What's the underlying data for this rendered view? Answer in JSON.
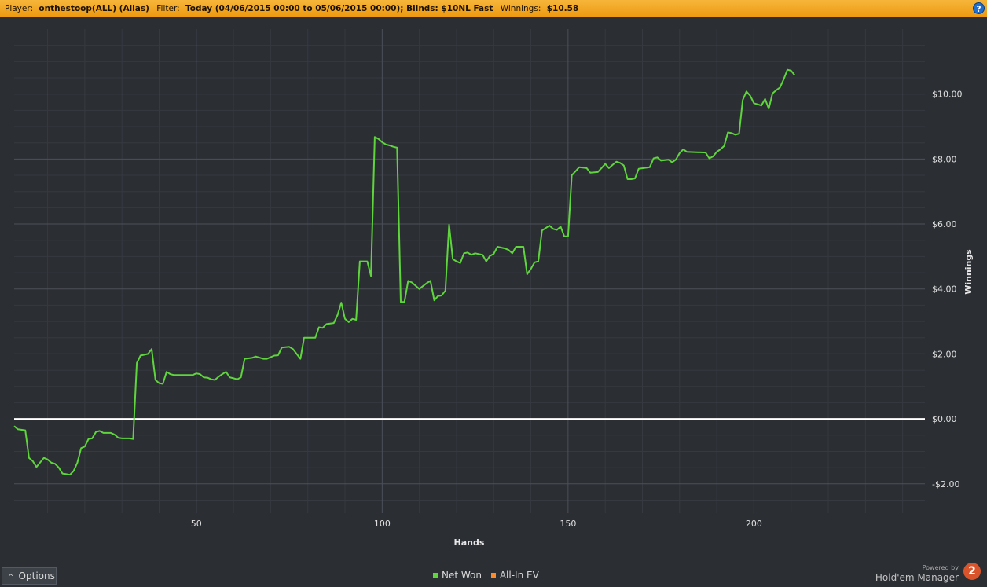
{
  "header": {
    "player_label": "Player:",
    "player_value": "onthestoop(ALL) (Alias)",
    "filter_label": "Filter:",
    "filter_value": "Today (04/06/2015 00:00 to 05/06/2015 00:00); Blinds: $10NL Fast",
    "winnings_label": "Winnings:",
    "winnings_value": "$10.58",
    "help_icon": "question-icon",
    "help_glyph": "?"
  },
  "colors": {
    "header_bg": "#f2a623",
    "net_won": "#5fd43c",
    "all_in_ev": "#ff8a2a",
    "zero_line": "#ffffff",
    "plot_bg": "#2b2e33"
  },
  "chart_data": {
    "type": "line",
    "xlabel": "Hands",
    "ylabel": "Winnings",
    "xlim": [
      1,
      246
    ],
    "ylim": [
      -2.9,
      12
    ],
    "x_ticks": [
      50,
      100,
      150,
      200
    ],
    "x_tick_labels": [
      "50",
      "100",
      "150",
      "200"
    ],
    "y_ticks": [
      -2,
      0,
      2,
      4,
      6,
      8,
      10
    ],
    "y_tick_labels": [
      "-$2.00",
      "$0.00",
      "$2.00",
      "$4.00",
      "$6.00",
      "$8.00",
      "$10.00"
    ],
    "grid": true,
    "legend_position": "bottom-center",
    "series": [
      {
        "name": "Net Won",
        "points": [
          [
            1,
            -0.22
          ],
          [
            2,
            -0.32
          ],
          [
            4,
            -0.35
          ],
          [
            5,
            -1.2
          ],
          [
            6,
            -1.3
          ],
          [
            7,
            -1.48
          ],
          [
            9,
            -1.2
          ],
          [
            10,
            -1.25
          ],
          [
            11,
            -1.35
          ],
          [
            12,
            -1.38
          ],
          [
            13,
            -1.5
          ],
          [
            14,
            -1.68
          ],
          [
            15,
            -1.7
          ],
          [
            16,
            -1.72
          ],
          [
            17,
            -1.6
          ],
          [
            18,
            -1.35
          ],
          [
            19,
            -0.9
          ],
          [
            20,
            -0.85
          ],
          [
            21,
            -0.62
          ],
          [
            22,
            -0.6
          ],
          [
            23,
            -0.4
          ],
          [
            24,
            -0.37
          ],
          [
            25,
            -0.43
          ],
          [
            27,
            -0.43
          ],
          [
            28,
            -0.48
          ],
          [
            29,
            -0.58
          ],
          [
            30,
            -0.6
          ],
          [
            32,
            -0.6
          ],
          [
            33,
            -0.62
          ],
          [
            34,
            1.72
          ],
          [
            35,
            1.95
          ],
          [
            37,
            2.0
          ],
          [
            38,
            2.15
          ],
          [
            39,
            1.2
          ],
          [
            40,
            1.1
          ],
          [
            41,
            1.08
          ],
          [
            42,
            1.45
          ],
          [
            43,
            1.38
          ],
          [
            44,
            1.35
          ],
          [
            49,
            1.35
          ],
          [
            50,
            1.4
          ],
          [
            51,
            1.38
          ],
          [
            52,
            1.28
          ],
          [
            53,
            1.27
          ],
          [
            54,
            1.22
          ],
          [
            55,
            1.2
          ],
          [
            56,
            1.3
          ],
          [
            57,
            1.38
          ],
          [
            58,
            1.45
          ],
          [
            59,
            1.28
          ],
          [
            60,
            1.25
          ],
          [
            61,
            1.22
          ],
          [
            62,
            1.28
          ],
          [
            63,
            1.85
          ],
          [
            65,
            1.88
          ],
          [
            66,
            1.92
          ],
          [
            68,
            1.85
          ],
          [
            69,
            1.85
          ],
          [
            71,
            1.95
          ],
          [
            72,
            1.96
          ],
          [
            73,
            2.2
          ],
          [
            75,
            2.22
          ],
          [
            76,
            2.15
          ],
          [
            77,
            2.0
          ],
          [
            78,
            1.85
          ],
          [
            79,
            2.5
          ],
          [
            82,
            2.5
          ],
          [
            83,
            2.82
          ],
          [
            84,
            2.8
          ],
          [
            85,
            2.92
          ],
          [
            87,
            2.95
          ],
          [
            88,
            3.2
          ],
          [
            89,
            3.58
          ],
          [
            90,
            3.08
          ],
          [
            91,
            2.98
          ],
          [
            92,
            3.08
          ],
          [
            93,
            3.05
          ],
          [
            94,
            4.85
          ],
          [
            96,
            4.85
          ],
          [
            97,
            4.4
          ],
          [
            98,
            8.68
          ],
          [
            99,
            8.62
          ],
          [
            100,
            8.52
          ],
          [
            101,
            8.45
          ],
          [
            102,
            8.42
          ],
          [
            103,
            8.38
          ],
          [
            104,
            8.35
          ],
          [
            105,
            3.6
          ],
          [
            106,
            3.6
          ],
          [
            107,
            4.25
          ],
          [
            108,
            4.2
          ],
          [
            109,
            4.1
          ],
          [
            110,
            4.0
          ],
          [
            112,
            4.18
          ],
          [
            113,
            4.25
          ],
          [
            114,
            3.65
          ],
          [
            115,
            3.78
          ],
          [
            116,
            3.8
          ],
          [
            117,
            3.95
          ],
          [
            118,
            5.98
          ],
          [
            119,
            4.92
          ],
          [
            120,
            4.85
          ],
          [
            121,
            4.8
          ],
          [
            122,
            5.1
          ],
          [
            123,
            5.12
          ],
          [
            124,
            5.05
          ],
          [
            125,
            5.1
          ],
          [
            127,
            5.05
          ],
          [
            128,
            4.85
          ],
          [
            129,
            5.02
          ],
          [
            130,
            5.08
          ],
          [
            131,
            5.3
          ],
          [
            133,
            5.25
          ],
          [
            134,
            5.2
          ],
          [
            135,
            5.1
          ],
          [
            136,
            5.3
          ],
          [
            138,
            5.3
          ],
          [
            139,
            4.45
          ],
          [
            140,
            4.62
          ],
          [
            141,
            4.82
          ],
          [
            142,
            4.85
          ],
          [
            143,
            5.8
          ],
          [
            145,
            5.95
          ],
          [
            146,
            5.85
          ],
          [
            147,
            5.82
          ],
          [
            148,
            5.92
          ],
          [
            149,
            5.62
          ],
          [
            150,
            5.62
          ],
          [
            151,
            7.5
          ],
          [
            152,
            7.62
          ],
          [
            153,
            7.75
          ],
          [
            155,
            7.72
          ],
          [
            156,
            7.58
          ],
          [
            158,
            7.6
          ],
          [
            159,
            7.72
          ],
          [
            160,
            7.85
          ],
          [
            161,
            7.72
          ],
          [
            162,
            7.82
          ],
          [
            163,
            7.92
          ],
          [
            164,
            7.88
          ],
          [
            165,
            7.8
          ],
          [
            166,
            7.38
          ],
          [
            167,
            7.38
          ],
          [
            168,
            7.4
          ],
          [
            169,
            7.7
          ],
          [
            172,
            7.75
          ],
          [
            173,
            8.02
          ],
          [
            174,
            8.05
          ],
          [
            175,
            7.95
          ],
          [
            177,
            7.98
          ],
          [
            178,
            7.9
          ],
          [
            179,
            7.98
          ],
          [
            180,
            8.18
          ],
          [
            181,
            8.3
          ],
          [
            182,
            8.22
          ],
          [
            187,
            8.2
          ],
          [
            188,
            8.02
          ],
          [
            189,
            8.08
          ],
          [
            190,
            8.22
          ],
          [
            191,
            8.3
          ],
          [
            192,
            8.4
          ],
          [
            193,
            8.82
          ],
          [
            194,
            8.8
          ],
          [
            195,
            8.75
          ],
          [
            196,
            8.78
          ],
          [
            197,
            9.82
          ],
          [
            198,
            10.08
          ],
          [
            199,
            9.95
          ],
          [
            200,
            9.72
          ],
          [
            202,
            9.65
          ],
          [
            203,
            9.85
          ],
          [
            204,
            9.55
          ],
          [
            205,
            10.02
          ],
          [
            206,
            10.12
          ],
          [
            207,
            10.2
          ],
          [
            208,
            10.45
          ],
          [
            209,
            10.75
          ],
          [
            210,
            10.72
          ],
          [
            211,
            10.58
          ]
        ]
      },
      {
        "name": "All-In EV",
        "points": []
      }
    ]
  },
  "bottom": {
    "options_label": "Options",
    "options_icon": "chevron-up-icon",
    "options_glyph": "^",
    "legend": [
      {
        "label": "Net Won",
        "color": "#5fd43c"
      },
      {
        "label": "All-In EV",
        "color": "#ff8a2a"
      }
    ],
    "powered_by": "Powered by",
    "brand_name": "Hold'em Manager",
    "brand_logo_text": "2"
  }
}
